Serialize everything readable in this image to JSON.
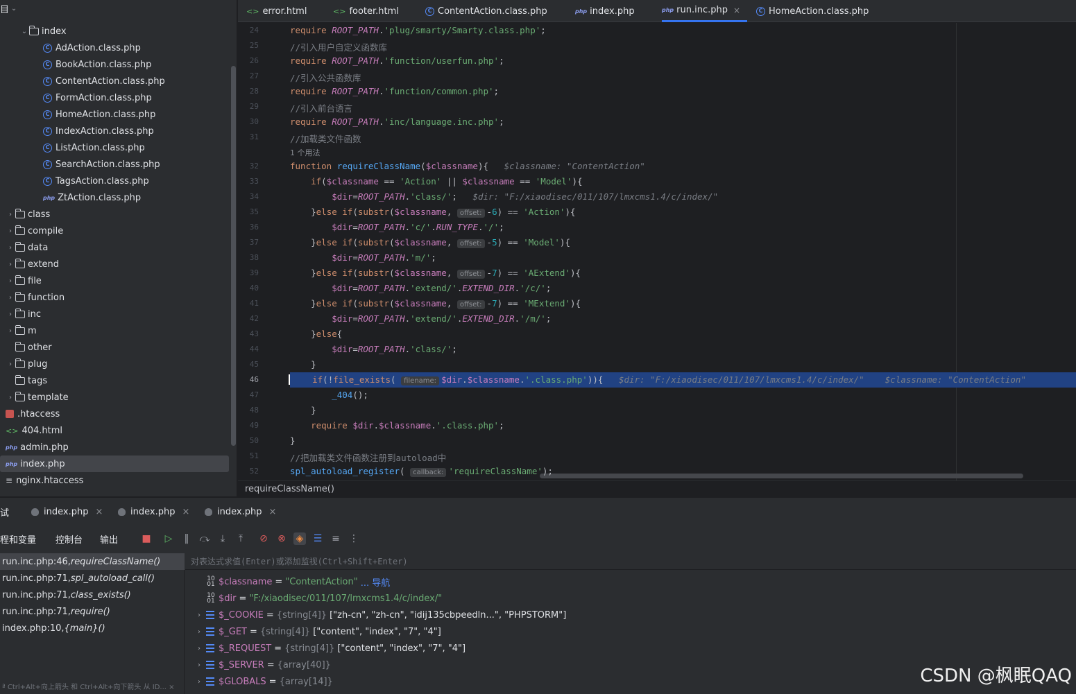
{
  "project_header": "目",
  "tree": [
    {
      "label": "index",
      "type": "folder",
      "open": true,
      "depth": 1
    },
    {
      "label": "AdAction.class.php",
      "type": "class",
      "depth": 3
    },
    {
      "label": "BookAction.class.php",
      "type": "class",
      "depth": 3
    },
    {
      "label": "ContentAction.class.php",
      "type": "class",
      "depth": 3
    },
    {
      "label": "FormAction.class.php",
      "type": "class",
      "depth": 3
    },
    {
      "label": "HomeAction.class.php",
      "type": "class",
      "depth": 3
    },
    {
      "label": "IndexAction.class.php",
      "type": "class",
      "depth": 3
    },
    {
      "label": "ListAction.class.php",
      "type": "class",
      "depth": 3
    },
    {
      "label": "SearchAction.class.php",
      "type": "class",
      "depth": 3
    },
    {
      "label": "TagsAction.class.php",
      "type": "class",
      "depth": 3
    },
    {
      "label": "ZtAction.class.php",
      "type": "php",
      "depth": 3
    },
    {
      "label": "class",
      "type": "folder",
      "depth": 0
    },
    {
      "label": "compile",
      "type": "folder",
      "depth": 0
    },
    {
      "label": "data",
      "type": "folder",
      "depth": 0
    },
    {
      "label": "extend",
      "type": "folder",
      "depth": 0
    },
    {
      "label": "file",
      "type": "folder",
      "depth": 0
    },
    {
      "label": "function",
      "type": "folder",
      "depth": 0
    },
    {
      "label": "inc",
      "type": "folder",
      "depth": 0
    },
    {
      "label": "m",
      "type": "folder",
      "depth": 0
    },
    {
      "label": "other",
      "type": "folder-nochev",
      "depth": 0
    },
    {
      "label": "plug",
      "type": "folder",
      "depth": 0
    },
    {
      "label": "tags",
      "type": "folder-nochev",
      "depth": 0
    },
    {
      "label": "template",
      "type": "folder",
      "depth": 0
    },
    {
      "label": ".htaccess",
      "type": "git",
      "depth": 0
    },
    {
      "label": "404.html",
      "type": "html",
      "depth": 0
    },
    {
      "label": "admin.php",
      "type": "php",
      "depth": 0
    },
    {
      "label": "index.php",
      "type": "php",
      "depth": 0,
      "selected": true
    },
    {
      "label": "nginx.htaccess",
      "type": "txt",
      "depth": 0
    }
  ],
  "tabs": [
    {
      "label": "error.html",
      "icon": "html-icon"
    },
    {
      "label": "footer.html",
      "icon": "html-icon"
    },
    {
      "label": "ContentAction.class.php",
      "icon": "class-icon"
    },
    {
      "label": "index.php",
      "icon": "php-icon"
    },
    {
      "label": "run.inc.php",
      "icon": "php-icon",
      "active": true,
      "close": "×"
    },
    {
      "label": "HomeAction.class.php",
      "icon": "class-icon"
    }
  ],
  "editor": {
    "current_line": "46",
    "usages": "1 个用法",
    "lines": [
      {
        "n": "24",
        "html": "<span class='kw'>require</span> <span class='cst'>ROOT_PATH</span>.<span class='st'>'plug/smarty/Smarty.class.php'</span>;"
      },
      {
        "n": "25",
        "html": "<span class='cm'>//引入用户自定义函数库</span>"
      },
      {
        "n": "26",
        "html": "<span class='kw'>require</span> <span class='cst'>ROOT_PATH</span>.<span class='st'>'function/userfun.php'</span>;"
      },
      {
        "n": "27",
        "html": "<span class='cm'>//引入公共函数库</span>"
      },
      {
        "n": "28",
        "html": "<span class='kw'>require</span> <span class='cst'>ROOT_PATH</span>.<span class='st'>'function/common.php'</span>;"
      },
      {
        "n": "29",
        "html": "<span class='cm'>//引入前台语言</span>"
      },
      {
        "n": "30",
        "html": "<span class='kw'>require</span> <span class='cst'>ROOT_PATH</span>.<span class='st'>'inc/language.inc.php'</span>;"
      },
      {
        "n": "31",
        "html": "<span class='cm'>//加载类文件函数</span>"
      },
      {
        "n": "32",
        "html": "<span class='kw'>function</span> <span class='fn'>requireClassName</span>(<span class='var'>$classname</span>){   <span class='inl'>$classname: \"ContentAction\"</span>"
      },
      {
        "n": "33",
        "html": "    <span class='kw'>if</span>(<span class='var'>$classname</span> == <span class='st'>'Action'</span> || <span class='var'>$classname</span> == <span class='st'>'Model'</span>){"
      },
      {
        "n": "34",
        "html": "        <span class='var'>$dir</span>=<span class='cst'>ROOT_PATH</span>.<span class='st'>'class/'</span>;   <span class='inl'>$dir: \"F:/xiaodisec/011/107/lmxcms1.4/c/index/\"</span>"
      },
      {
        "n": "35",
        "html": "    }<span class='kw'>else if</span>(<span class='kw'>substr</span>(<span class='var'>$classname</span>, <span class='hint'>offset:</span>-<span class='num'>6</span>) == <span class='st'>'Action'</span>){"
      },
      {
        "n": "36",
        "html": "        <span class='var'>$dir</span>=<span class='cst'>ROOT_PATH</span>.<span class='st'>'c/'</span>.<span class='cst'>RUN_TYPE</span>.<span class='st'>'/'</span>;"
      },
      {
        "n": "37",
        "html": "    }<span class='kw'>else if</span>(<span class='kw'>substr</span>(<span class='var'>$classname</span>, <span class='hint'>offset:</span>-<span class='num'>5</span>) == <span class='st'>'Model'</span>){"
      },
      {
        "n": "38",
        "html": "        <span class='var'>$dir</span>=<span class='cst'>ROOT_PATH</span>.<span class='st'>'m/'</span>;"
      },
      {
        "n": "39",
        "html": "    }<span class='kw'>else if</span>(<span class='kw'>substr</span>(<span class='var'>$classname</span>, <span class='hint'>offset:</span>-<span class='num'>7</span>) == <span class='st'>'AExtend'</span>){"
      },
      {
        "n": "40",
        "html": "        <span class='var'>$dir</span>=<span class='cst'>ROOT_PATH</span>.<span class='st'>'extend/'</span>.<span class='cst'>EXTEND_DIR</span>.<span class='st'>'/c/'</span>;"
      },
      {
        "n": "41",
        "html": "    }<span class='kw'>else if</span>(<span class='kw'>substr</span>(<span class='var'>$classname</span>, <span class='hint'>offset:</span>-<span class='num'>7</span>) == <span class='st'>'MExtend'</span>){"
      },
      {
        "n": "42",
        "html": "        <span class='var'>$dir</span>=<span class='cst'>ROOT_PATH</span>.<span class='st'>'extend/'</span>.<span class='cst'>EXTEND_DIR</span>.<span class='st'>'/m/'</span>;"
      },
      {
        "n": "43",
        "html": "    }<span class='kw'>else</span>{"
      },
      {
        "n": "44",
        "html": "        <span class='var'>$dir</span>=<span class='cst'>ROOT_PATH</span>.<span class='st'>'class/'</span>;"
      },
      {
        "n": "45",
        "html": "    }"
      },
      {
        "n": "46",
        "html": "    <span class='kw'>if</span>(!<span class='kw'>file_exists</span>( <span class='hint'>filename:</span><span class='var'>$dir</span>.<span class='var'>$classname</span>.<span class='st'>'.class.php'</span>)){   <span class='inl'>$dir: \"F:/xiaodisec/011/107/lmxcms1.4/c/index/\"    $classname: \"ContentAction\"</span>",
        "hl": true
      },
      {
        "n": "47",
        "html": "        <span class='fn'>_404</span>();"
      },
      {
        "n": "48",
        "html": "    }"
      },
      {
        "n": "49",
        "html": "    <span class='kw'>require</span> <span class='var'>$dir</span>.<span class='var'>$classname</span>.<span class='st'>'.class.php'</span>;"
      },
      {
        "n": "50",
        "html": "}"
      },
      {
        "n": "51",
        "html": "<span class='cm'>//把加载类文件函数注册到autoload中</span>"
      },
      {
        "n": "52",
        "html": "<span class='fn'>spl_autoload_register</span>( <span class='hint'>callback:</span><span class='st'>'requireClassName'</span>);"
      }
    ]
  },
  "breadcrumb": "requireClassName()",
  "debug": {
    "panel_label": "试",
    "sessions": [
      "index.php",
      "index.php",
      "index.php"
    ],
    "close": "×",
    "toolbar": {
      "threads": "程和变量",
      "console": "控制台",
      "output": "输出"
    },
    "frames": [
      {
        "file": "run.inc.php:46, ",
        "fn": "requireClassName()",
        "selected": true
      },
      {
        "file": "run.inc.php:71, ",
        "fn": "spl_autoload_call()"
      },
      {
        "file": "run.inc.php:71, ",
        "fn": "class_exists()"
      },
      {
        "file": "run.inc.php:71, ",
        "fn": "require()"
      },
      {
        "file": "index.php:10, ",
        "fn": "{main}()"
      }
    ],
    "frames_hint": "ª Ctrl+Alt+向上箭头 和 Ctrl+Alt+向下箭头 从 ID... ×",
    "eval_placeholder": "对表达式求值(Enter)或添加监视(Ctrl+Shift+Enter)",
    "vars": [
      {
        "name": "$classname",
        "eq": "=",
        "val": "\"ContentAction\"",
        "extra": "... 导航",
        "kind": "scalar"
      },
      {
        "name": "$dir",
        "eq": "=",
        "val": "\"F:/xiaodisec/011/107/lmxcms1.4/c/index/\"",
        "kind": "scalar"
      },
      {
        "name": "$_COOKIE",
        "eq": "=",
        "type": "{string[4]}",
        "plain": "[\"zh-cn\", \"zh-cn\", \"idij135cbpeedln...\", \"PHPSTORM\"]",
        "kind": "array"
      },
      {
        "name": "$_GET",
        "eq": "=",
        "type": "{string[4]}",
        "plain": "[\"content\", \"index\", \"7\", \"4\"]",
        "kind": "array"
      },
      {
        "name": "$_REQUEST",
        "eq": "=",
        "type": "{string[4]}",
        "plain": "[\"content\", \"index\", \"7\", \"4\"]",
        "kind": "array"
      },
      {
        "name": "$_SERVER",
        "eq": "=",
        "type": "{array[40]}",
        "plain": "",
        "kind": "array"
      },
      {
        "name": "$GLOBALS",
        "eq": "=",
        "type": "{array[14]}",
        "plain": "",
        "kind": "array"
      }
    ]
  },
  "watermark": "CSDN @枫眠QAQ"
}
